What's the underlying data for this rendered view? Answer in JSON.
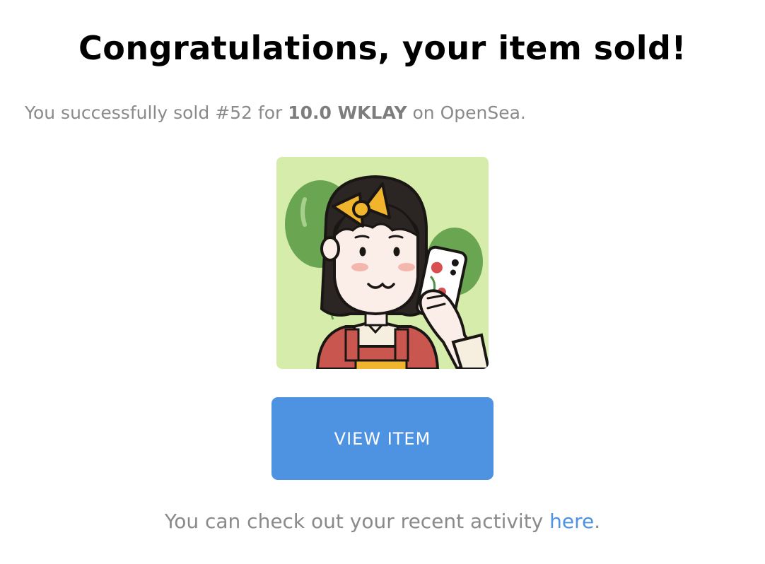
{
  "header": {
    "title": "Congratulations, your item sold!"
  },
  "message": {
    "prefix": "You successfully sold #52 for ",
    "amount": "10.0 WKLAY",
    "suffix": " on OpenSea."
  },
  "nft": {
    "subject": "girl-with-phone-and-balloons",
    "colors": {
      "background": "#d6ecaa",
      "balloon": "#6aa552",
      "hair": "#2b2523",
      "bow": "#f0b52d",
      "skin": "#fbeee8",
      "overalls": "#c9574f"
    }
  },
  "actions": {
    "view_item_label": "VIEW ITEM"
  },
  "footer": {
    "prefix": "You can check out your recent activity ",
    "link_label": "here",
    "suffix": "."
  },
  "colors": {
    "accent": "#4e93e1",
    "muted_text": "#8a8a8a"
  }
}
